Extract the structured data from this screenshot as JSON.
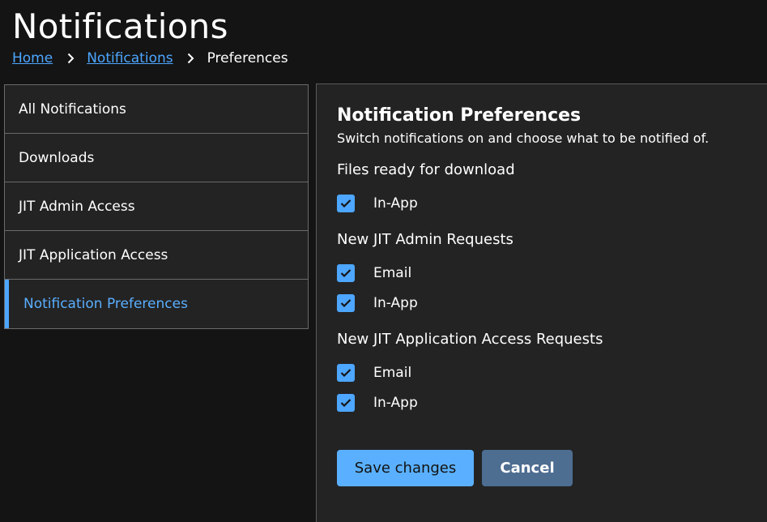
{
  "page": {
    "title": "Notifications"
  },
  "breadcrumb": {
    "items": [
      {
        "label": "Home"
      },
      {
        "label": "Notifications"
      },
      {
        "label": "Preferences"
      }
    ]
  },
  "sidebar": {
    "items": [
      {
        "label": "All Notifications"
      },
      {
        "label": "Downloads"
      },
      {
        "label": "JIT Admin Access"
      },
      {
        "label": "JIT Application Access"
      },
      {
        "label": "Notification Preferences",
        "active": true
      }
    ]
  },
  "preferences": {
    "title": "Notification Preferences",
    "subtitle": "Switch notifications on and choose what to be notified of.",
    "groups": [
      {
        "title": "Files ready for download",
        "options": [
          {
            "label": "In-App",
            "checked": true
          }
        ]
      },
      {
        "title": "New JIT Admin Requests",
        "options": [
          {
            "label": "Email",
            "checked": true
          },
          {
            "label": "In-App",
            "checked": true
          }
        ]
      },
      {
        "title": "New JIT Application Access Requests",
        "options": [
          {
            "label": "Email",
            "checked": true
          },
          {
            "label": "In-App",
            "checked": true
          }
        ]
      }
    ]
  },
  "actions": {
    "save_label": "Save changes",
    "cancel_label": "Cancel"
  },
  "colors": {
    "accent": "#4da6ff",
    "background": "#141414",
    "panel": "#232323",
    "cancel_button": "#4d6d91"
  },
  "icons": {
    "breadcrumb_separator": "chevron-right-icon",
    "checkbox_mark": "checkmark-icon"
  }
}
